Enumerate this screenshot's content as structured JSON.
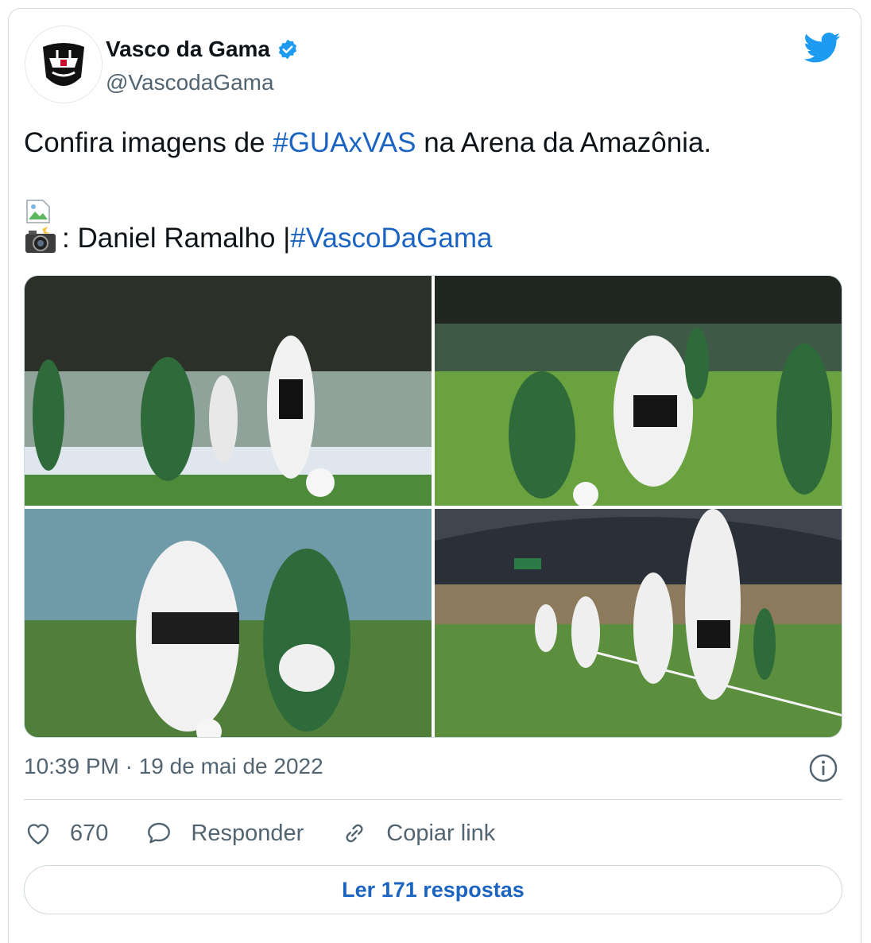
{
  "tweet": {
    "author_name": "Vasco da Gama",
    "author_handle": "@VascodaGama",
    "text_before_hashtag": "Confira imagens de ",
    "hashtag1": "#GUAxVAS",
    "text_after_hashtag": " na Arena da Amazônia.",
    "credit_prefix": ": Daniel Ramalho | ",
    "hashtag2": "#VascoDaGama",
    "timestamp": "10:39 PM · 19 de mai de 2022"
  },
  "icons": {
    "avatar": "vasco-crest-icon",
    "verified": "verified-badge-icon",
    "brand": "twitter-bird-icon",
    "broken_image": "broken-image-icon",
    "camera": "camera-flash-icon",
    "info": "info-icon",
    "like": "heart-icon",
    "reply": "speech-bubble-icon",
    "copy": "link-icon"
  },
  "actions": {
    "likes": "670",
    "reply_label": "Responder",
    "copy_label": "Copiar link"
  },
  "read_replies": "Ler 171 respostas",
  "colors": {
    "link_blue": "#1b64c2",
    "twitter_blue": "#1d9bf0",
    "text": "#0f1419",
    "muted": "#536471",
    "border": "#cfd9de"
  }
}
